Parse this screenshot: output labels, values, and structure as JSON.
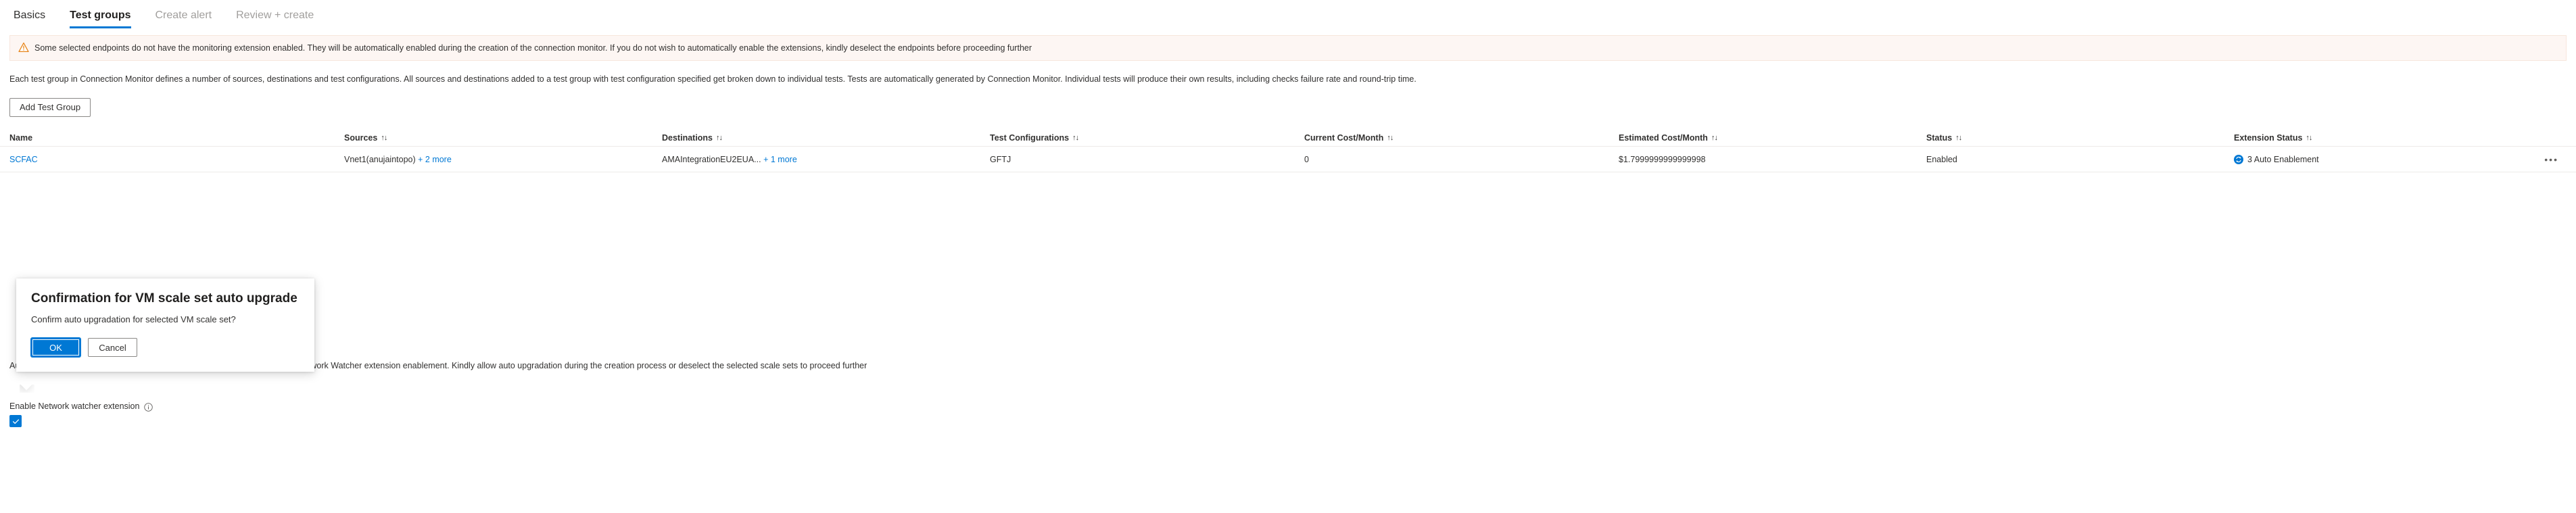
{
  "wizard": {
    "tabs": [
      {
        "label": "Basics",
        "state": "enabled"
      },
      {
        "label": "Test groups",
        "state": "selected"
      },
      {
        "label": "Create alert",
        "state": "disabled"
      },
      {
        "label": "Review + create",
        "state": "disabled"
      }
    ]
  },
  "banner": {
    "icon": "warning-icon",
    "text": "Some selected endpoints do not have the monitoring extension enabled. They will be automatically enabled during the creation of the connection monitor. If you do not wish to automatically enable the extensions, kindly deselect the endpoints before proceeding further",
    "background": "#fdf6f3",
    "icon_color": "#e8851a"
  },
  "intro": {
    "text": "Each test group in Connection Monitor defines a number of sources, destinations and test configurations. All sources and destinations added to a test group with test configuration specified get broken down to individual tests. Tests are automatically generated by Connection Monitor. Individual tests will produce their own results, including checks failure rate and round-trip time."
  },
  "toolbar": {
    "add_test_group_label": "Add Test Group"
  },
  "table": {
    "sort_glyph": "↑↓",
    "columns": [
      {
        "label": "Name",
        "sortable": false
      },
      {
        "label": "Sources",
        "sortable": true
      },
      {
        "label": "Destinations",
        "sortable": true
      },
      {
        "label": "Test Configurations",
        "sortable": true
      },
      {
        "label": "Current Cost/Month",
        "sortable": true
      },
      {
        "label": "Estimated Cost/Month",
        "sortable": true
      },
      {
        "label": "Status",
        "sortable": true
      },
      {
        "label": "Extension Status",
        "sortable": true
      }
    ],
    "rows": [
      {
        "name": "SCFAC",
        "sources_primary": "Vnet1(anujaintopo)",
        "sources_more": "+ 2 more",
        "destinations_primary": "AMAIntegrationEU2EUA...",
        "destinations_more": "+ 1 more",
        "test_configurations": "GFTJ",
        "current_cost": "0",
        "estimated_cost": "$1.7999999999999998",
        "status": "Enabled",
        "extension_status": "3 Auto Enablement",
        "extension_icon": "auto-enablement-icon",
        "row_menu": "•••"
      }
    ]
  },
  "warning_secondary": {
    "text": "Auto upgradation is disabled for selected VM scale sets which is required for Network Watcher extension enablement. Kindly allow auto upgradation during the creation process or deselect the selected scale sets to proceed further"
  },
  "network_watcher": {
    "label": "Enable Network watcher extension",
    "info_icon": "info-icon",
    "checked": true,
    "checkbox_color": "#0078d4"
  },
  "callout": {
    "title": "Confirmation for VM scale set auto upgrade",
    "message": "Confirm auto upgradation for selected VM scale set?",
    "ok_label": "OK",
    "cancel_label": "Cancel",
    "primary_color": "#0078d4"
  }
}
